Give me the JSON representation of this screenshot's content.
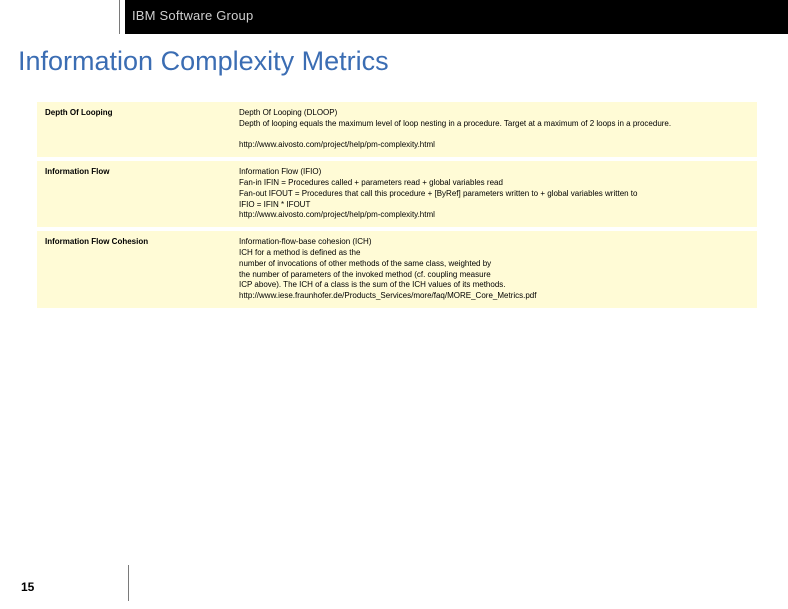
{
  "header": {
    "brand": "IBM Software Group"
  },
  "slide": {
    "title": "Information Complexity Metrics",
    "page_number": "15"
  },
  "rows": [
    {
      "name": "Depth Of Looping",
      "desc": "Depth Of Looping (DLOOP)\nDepth of looping equals the maximum level of loop nesting in a procedure. Target at a maximum of 2 loops in a procedure.\n\nhttp://www.aivosto.com/project/help/pm-complexity.html"
    },
    {
      "name": "Information Flow",
      "desc": "Information Flow (IFIO)\nFan-in IFIN = Procedures called + parameters read + global variables read\nFan-out IFOUT = Procedures that call this procedure + [ByRef] parameters written to + global variables written to\nIFIO = IFIN * IFOUT\nhttp://www.aivosto.com/project/help/pm-complexity.html"
    },
    {
      "name": "Information Flow Cohesion",
      "desc": "Information-flow-base cohesion (ICH)\nICH for a method is defined as the\nnumber of invocations of other methods of the same class, weighted by\nthe number of parameters of the invoked method (cf. coupling measure\nICP above). The ICH of a class is the sum of the ICH values of its methods.\nhttp://www.iese.fraunhofer.de/Products_Services/more/faq/MORE_Core_Metrics.pdf"
    }
  ]
}
